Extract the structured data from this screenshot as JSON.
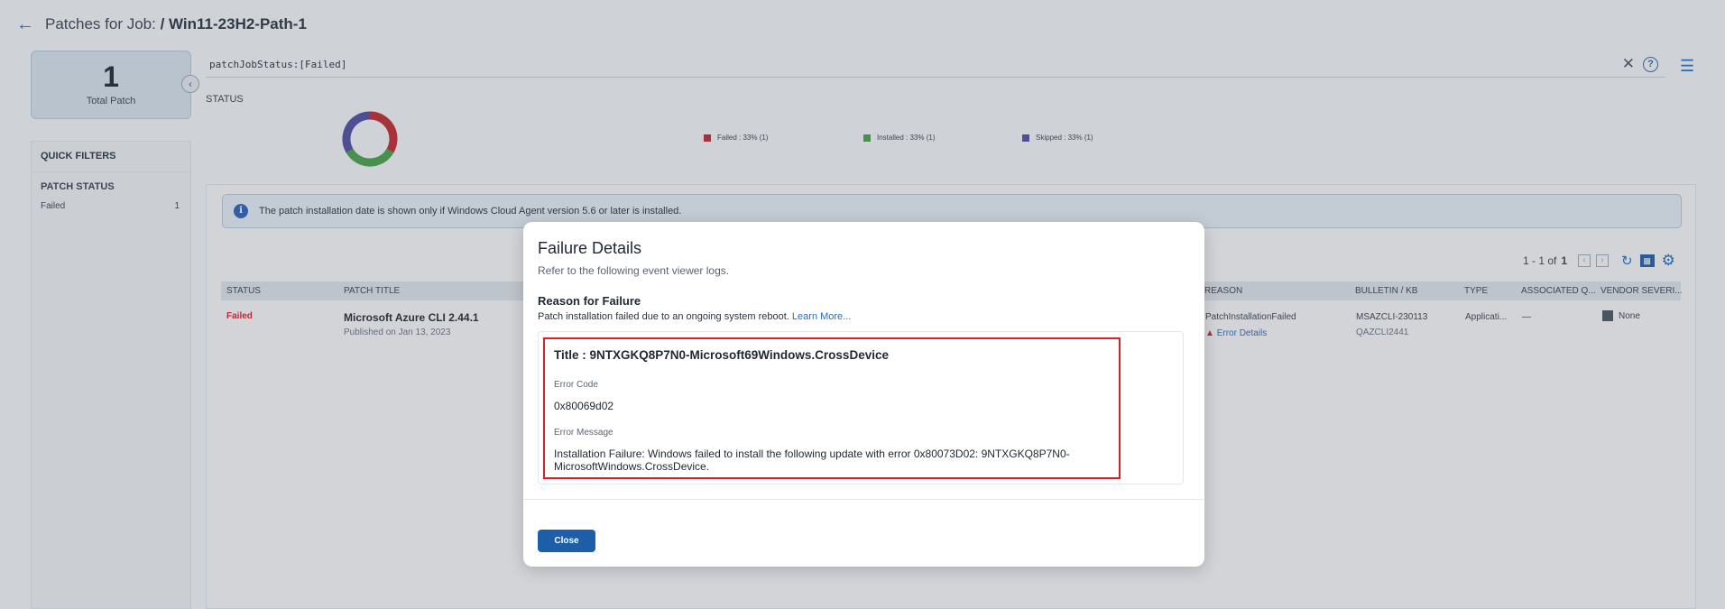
{
  "header": {
    "title_prefix": "Patches for Job:",
    "title_job": "/ Win11-23H2-Path-1"
  },
  "total": {
    "value": "1",
    "label": "Total Patch"
  },
  "filters": {
    "quick_filters": "QUICK FILTERS",
    "patch_status_heading": "PATCH STATUS",
    "items": [
      {
        "label": "Failed",
        "count": "1"
      }
    ]
  },
  "search": {
    "value": "patchJobStatus:[Failed]"
  },
  "status_chart": {
    "heading": "STATUS",
    "legend": [
      {
        "label": "Failed : 33% (1)",
        "color": "#c0282f"
      },
      {
        "label": "Installed : 33% (1)",
        "color": "#47a14a"
      },
      {
        "label": "Skipped : 33% (1)",
        "color": "#4b4fa0"
      }
    ]
  },
  "info_banner": {
    "text": "The patch installation date is shown only if Windows Cloud Agent version 5.6 or later is installed."
  },
  "pager": {
    "range": "1 - 1 of",
    "total": "1"
  },
  "table": {
    "columns": {
      "status": "STATUS",
      "patch_title": "PATCH TITLE",
      "reason": "REASON",
      "bulletin": "BULLETIN / KB",
      "type": "TYPE",
      "associated": "ASSOCIATED Q...",
      "vendor": "VENDOR SEVERI..."
    },
    "row": {
      "status": "Failed",
      "title": "Microsoft Azure CLI 2.44.1",
      "published": "Published on Jan 13, 2023",
      "reason": "PatchInstallationFailed",
      "error_link": "Error Details",
      "bulletin": "MSAZCLI-230113",
      "kb": "QAZCLI2441",
      "type": "Applicati...",
      "associated": "—",
      "vendor": "None"
    }
  },
  "modal": {
    "title": "Failure Details",
    "subtitle": "Refer to the following event viewer logs.",
    "reason_heading": "Reason for Failure",
    "reason_text": "Patch installation failed due to an ongoing system reboot.",
    "learn_more": "Learn More...",
    "log": {
      "title": "Title : 9NTXGKQ8P7N0-Microsoft69Windows.CrossDevice",
      "error_code_label": "Error Code",
      "error_code": "0x80069d02",
      "error_message_label": "Error Message",
      "error_message": "Installation Failure: Windows failed to install the following update with error 0x80073D02: 9NTXGKQ8P7N0-MicrosoftWindows.CrossDevice."
    },
    "close_label": "Close"
  }
}
